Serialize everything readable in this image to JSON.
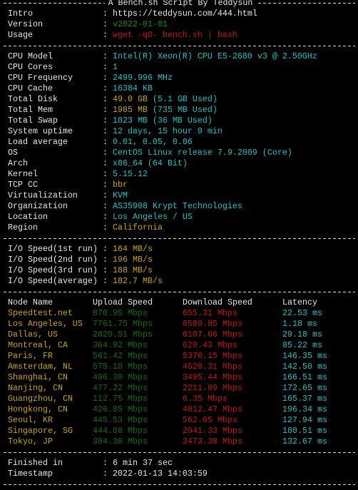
{
  "title": "A Bench.sh Script By Teddysun",
  "colors": {
    "white": "#e6e6e6",
    "green": "#1f8a1f",
    "red": "#c41414",
    "cyan": "#19c3c3",
    "yellow": "#c7a500"
  },
  "sections": [
    [
      {
        "label": "Intro",
        "value": "https://teddysun.com/444.html",
        "color": "white"
      },
      {
        "label": "Version",
        "value": "v2022-01-01",
        "color": "green"
      },
      {
        "label": "Usage",
        "value": "wget -qO- bench.sh | bash",
        "color": "red"
      }
    ],
    [
      {
        "label": "CPU Model",
        "value": "Intel(R) Xeon(R) CPU E5-2680 v3 @ 2.50GHz",
        "color": "cyan"
      },
      {
        "label": "CPU Cores",
        "value": "1",
        "color": "cyan"
      },
      {
        "label": "CPU Frequency",
        "value": "2499.996 MHz",
        "color": "cyan"
      },
      {
        "label": "CPU Cache",
        "value": "16384 KB",
        "color": "cyan"
      },
      {
        "label": "Total Disk",
        "value": "49.0 GB",
        "extra": " (5.1 GB Used)",
        "color": "yellow"
      },
      {
        "label": "Total Mem",
        "value": "1985 MB",
        "extra": " (735 MB Used)",
        "color": "yellow"
      },
      {
        "label": "Total Swap",
        "value": "1023 MB (36 MB Used)",
        "color": "cyan"
      },
      {
        "label": "System uptime",
        "value": "12 days, 15 hour 9 min",
        "color": "cyan"
      },
      {
        "label": "Load average",
        "value": "0.01, 0.05, 0.06",
        "color": "cyan"
      },
      {
        "label": "OS",
        "value": "CentOS Linux release 7.9.2009 (Core)",
        "color": "cyan"
      },
      {
        "label": "Arch",
        "value": "x86_64 (64 Bit)",
        "color": "cyan"
      },
      {
        "label": "Kernel",
        "value": "5.15.12",
        "color": "cyan"
      },
      {
        "label": "TCP CC",
        "value": "bbr",
        "color": "yellow"
      },
      {
        "label": "Virtualization",
        "value": "KVM",
        "color": "cyan"
      },
      {
        "label": "Organization",
        "value": "AS35908 Krypt Technologies",
        "color": "cyan"
      },
      {
        "label": "Location",
        "value": "Los Angeles / US",
        "color": "cyan"
      },
      {
        "label": "Region",
        "value": "California",
        "color": "yellow"
      }
    ],
    [
      {
        "label": "I/O Speed(1st run)",
        "value": "164 MB/s",
        "color": "yellow"
      },
      {
        "label": "I/O Speed(2nd run)",
        "value": "196 MB/s",
        "color": "yellow"
      },
      {
        "label": "I/O Speed(3rd run)",
        "value": "188 MB/s",
        "color": "yellow"
      },
      {
        "label": "I/O Speed(average)",
        "value": "182.7 MB/s",
        "color": "yellow"
      }
    ]
  ],
  "speedtest": {
    "headers": [
      "Node Name",
      "Upload Speed",
      "Download Speed",
      "Latency"
    ],
    "rows": [
      [
        "Speedtest.net",
        "870.95 Mbps",
        "655.31 Mbps",
        "22.53 ms"
      ],
      [
        "Los Angeles, US",
        "7761.75 Mbps",
        "8589.85 Mbps",
        "1.18 ms"
      ],
      [
        "Dallas, US",
        "2829.51 Mbps",
        "6107.66 Mbps",
        "29.18 ms"
      ],
      [
        "Montreal, CA",
        "364.92 Mbps",
        "629.43 Mbps",
        "85.22 ms"
      ],
      [
        "Paris, FR",
        "561.42 Mbps",
        "5370.15 Mbps",
        "146.35 ms"
      ],
      [
        "Amsterdam, NL",
        "575.18 Mbps",
        "4520.31 Mbps",
        "142.50 ms"
      ],
      [
        "Shanghai, CN",
        "496.30 Mbps",
        "3495.44 Mbps",
        "166.51 ms"
      ],
      [
        "Nanjing, CN",
        "477.22 Mbps",
        "2211.89 Mbps",
        "172.65 ms"
      ],
      [
        "Guangzhou, CN",
        "112.75 Mbps",
        "6.35 Mbps",
        "165.37 ms"
      ],
      [
        "Hongkong, CN",
        "426.85 Mbps",
        "4012.47 Mbps",
        "196.34 ms"
      ],
      [
        "Seoul, KR",
        "445.53 Mbps",
        "562.05 Mbps",
        "127.94 ms"
      ],
      [
        "Singapore, SG",
        "444.88 Mbps",
        "2941.33 Mbps",
        "180.51 ms"
      ],
      [
        "Tokyo, JP",
        "394.30 Mbps",
        "3473.38 Mbps",
        "132.67 ms"
      ]
    ]
  },
  "footer": [
    {
      "label": "Finished in",
      "value": "6 min 37 sec",
      "color": "white"
    },
    {
      "label": "Timestamp",
      "value": "2022-01-13 14:03:59",
      "color": "white"
    }
  ]
}
